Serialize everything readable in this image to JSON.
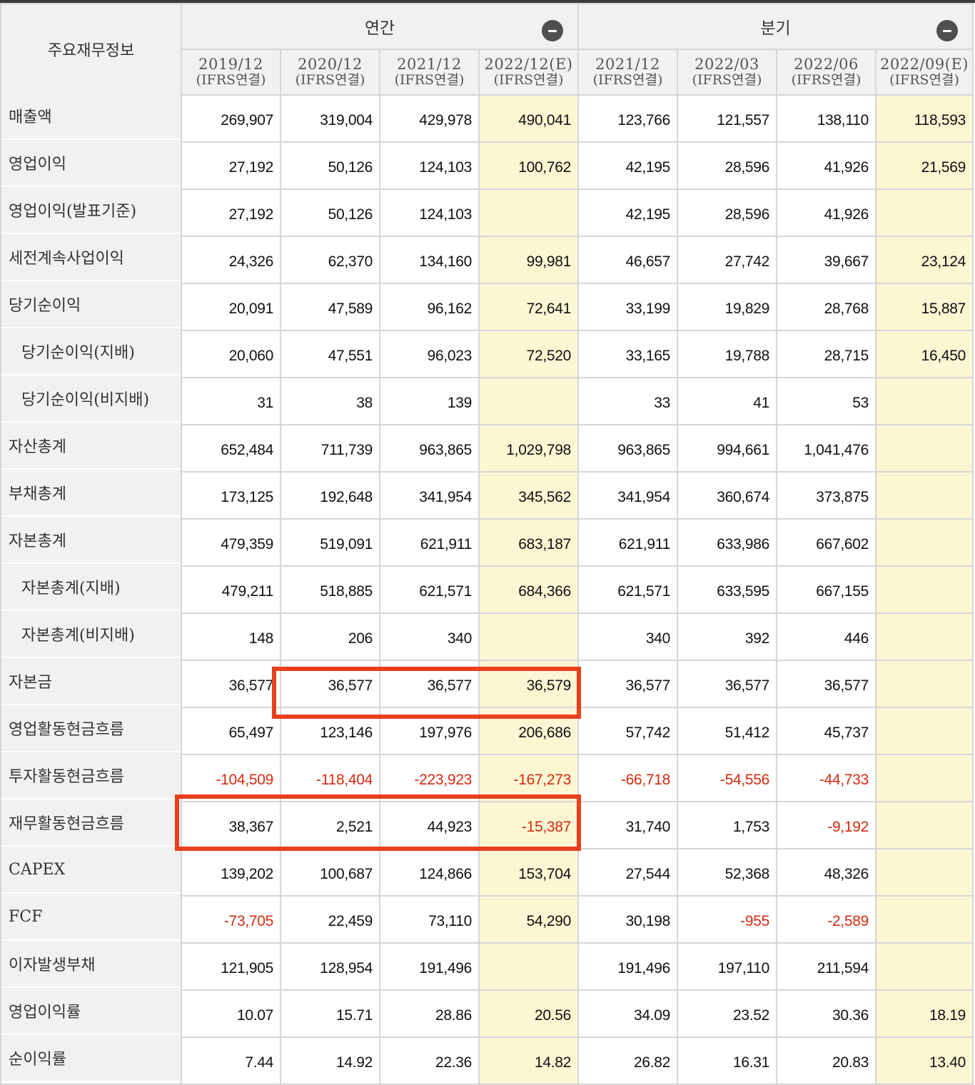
{
  "header": {
    "corner_label": "주요재무정보",
    "annual_label": "연간",
    "quarter_label": "분기",
    "collapse_icon": "minus-circle-icon",
    "periods": [
      {
        "date": "2019/12",
        "type": "(IFRS연결)",
        "estimate": false
      },
      {
        "date": "2020/12",
        "type": "(IFRS연결)",
        "estimate": false
      },
      {
        "date": "2021/12",
        "type": "(IFRS연결)",
        "estimate": false
      },
      {
        "date": "2022/12(E)",
        "type": "(IFRS연결)",
        "estimate": true
      },
      {
        "date": "2021/12",
        "type": "(IFRS연결)",
        "estimate": false
      },
      {
        "date": "2022/03",
        "type": "(IFRS연결)",
        "estimate": false
      },
      {
        "date": "2022/06",
        "type": "(IFRS연결)",
        "estimate": false
      },
      {
        "date": "2022/09(E)",
        "type": "(IFRS연결)",
        "estimate": true
      }
    ]
  },
  "colors": {
    "negative": "#d42b0f",
    "estimate_bg": "#fcf6d3",
    "label_bg": "#f1f1f1",
    "highlight_box": "#e8401c"
  },
  "rows": [
    {
      "label": "매출액",
      "sub": false,
      "values": [
        "269,907",
        "319,004",
        "429,978",
        "490,041",
        "123,766",
        "121,557",
        "138,110",
        "118,593"
      ]
    },
    {
      "label": "영업이익",
      "sub": false,
      "values": [
        "27,192",
        "50,126",
        "124,103",
        "100,762",
        "42,195",
        "28,596",
        "41,926",
        "21,569"
      ]
    },
    {
      "label": "영업이익(발표기준)",
      "sub": false,
      "values": [
        "27,192",
        "50,126",
        "124,103",
        "",
        "42,195",
        "28,596",
        "41,926",
        ""
      ]
    },
    {
      "label": "세전계속사업이익",
      "sub": false,
      "values": [
        "24,326",
        "62,370",
        "134,160",
        "99,981",
        "46,657",
        "27,742",
        "39,667",
        "23,124"
      ]
    },
    {
      "label": "당기순이익",
      "sub": false,
      "values": [
        "20,091",
        "47,589",
        "96,162",
        "72,641",
        "33,199",
        "19,829",
        "28,768",
        "15,887"
      ]
    },
    {
      "label": "당기순이익(지배)",
      "sub": true,
      "values": [
        "20,060",
        "47,551",
        "96,023",
        "72,520",
        "33,165",
        "19,788",
        "28,715",
        "16,450"
      ]
    },
    {
      "label": "당기순이익(비지배)",
      "sub": true,
      "values": [
        "31",
        "38",
        "139",
        "",
        "33",
        "41",
        "53",
        ""
      ]
    },
    {
      "label": "자산총계",
      "sub": false,
      "values": [
        "652,484",
        "711,739",
        "963,865",
        "1,029,798",
        "963,865",
        "994,661",
        "1,041,476",
        ""
      ]
    },
    {
      "label": "부채총계",
      "sub": false,
      "values": [
        "173,125",
        "192,648",
        "341,954",
        "345,562",
        "341,954",
        "360,674",
        "373,875",
        ""
      ]
    },
    {
      "label": "자본총계",
      "sub": false,
      "values": [
        "479,359",
        "519,091",
        "621,911",
        "683,187",
        "621,911",
        "633,986",
        "667,602",
        ""
      ]
    },
    {
      "label": "자본총계(지배)",
      "sub": true,
      "values": [
        "479,211",
        "518,885",
        "621,571",
        "684,366",
        "621,571",
        "633,595",
        "667,155",
        ""
      ]
    },
    {
      "label": "자본총계(비지배)",
      "sub": true,
      "values": [
        "148",
        "206",
        "340",
        "",
        "340",
        "392",
        "446",
        ""
      ]
    },
    {
      "label": "자본금",
      "sub": false,
      "values": [
        "36,577",
        "36,577",
        "36,577",
        "36,579",
        "36,577",
        "36,577",
        "36,577",
        ""
      ]
    },
    {
      "label": "영업활동현금흐름",
      "sub": false,
      "values": [
        "65,497",
        "123,146",
        "197,976",
        "206,686",
        "57,742",
        "51,412",
        "45,737",
        ""
      ]
    },
    {
      "label": "투자활동현금흐름",
      "sub": false,
      "values": [
        "-104,509",
        "-118,404",
        "-223,923",
        "-167,273",
        "-66,718",
        "-54,556",
        "-44,733",
        ""
      ]
    },
    {
      "label": "재무활동현금흐름",
      "sub": false,
      "values": [
        "38,367",
        "2,521",
        "44,923",
        "-15,387",
        "31,740",
        "1,753",
        "-9,192",
        ""
      ]
    },
    {
      "label": "CAPEX",
      "sub": false,
      "values": [
        "139,202",
        "100,687",
        "124,866",
        "153,704",
        "27,544",
        "52,368",
        "48,326",
        ""
      ]
    },
    {
      "label": "FCF",
      "sub": false,
      "values": [
        "-73,705",
        "22,459",
        "73,110",
        "54,290",
        "30,198",
        "-955",
        "-2,589",
        ""
      ]
    },
    {
      "label": "이자발생부채",
      "sub": false,
      "values": [
        "121,905",
        "128,954",
        "191,496",
        "",
        "191,496",
        "197,110",
        "211,594",
        ""
      ]
    },
    {
      "label": "영업이익률",
      "sub": false,
      "values": [
        "10.07",
        "15.71",
        "28.86",
        "20.56",
        "34.09",
        "23.52",
        "30.36",
        "18.19"
      ]
    },
    {
      "label": "순이익률",
      "sub": false,
      "values": [
        "7.44",
        "14.92",
        "22.36",
        "14.82",
        "26.82",
        "16.31",
        "20.83",
        "13.40"
      ]
    }
  ]
}
